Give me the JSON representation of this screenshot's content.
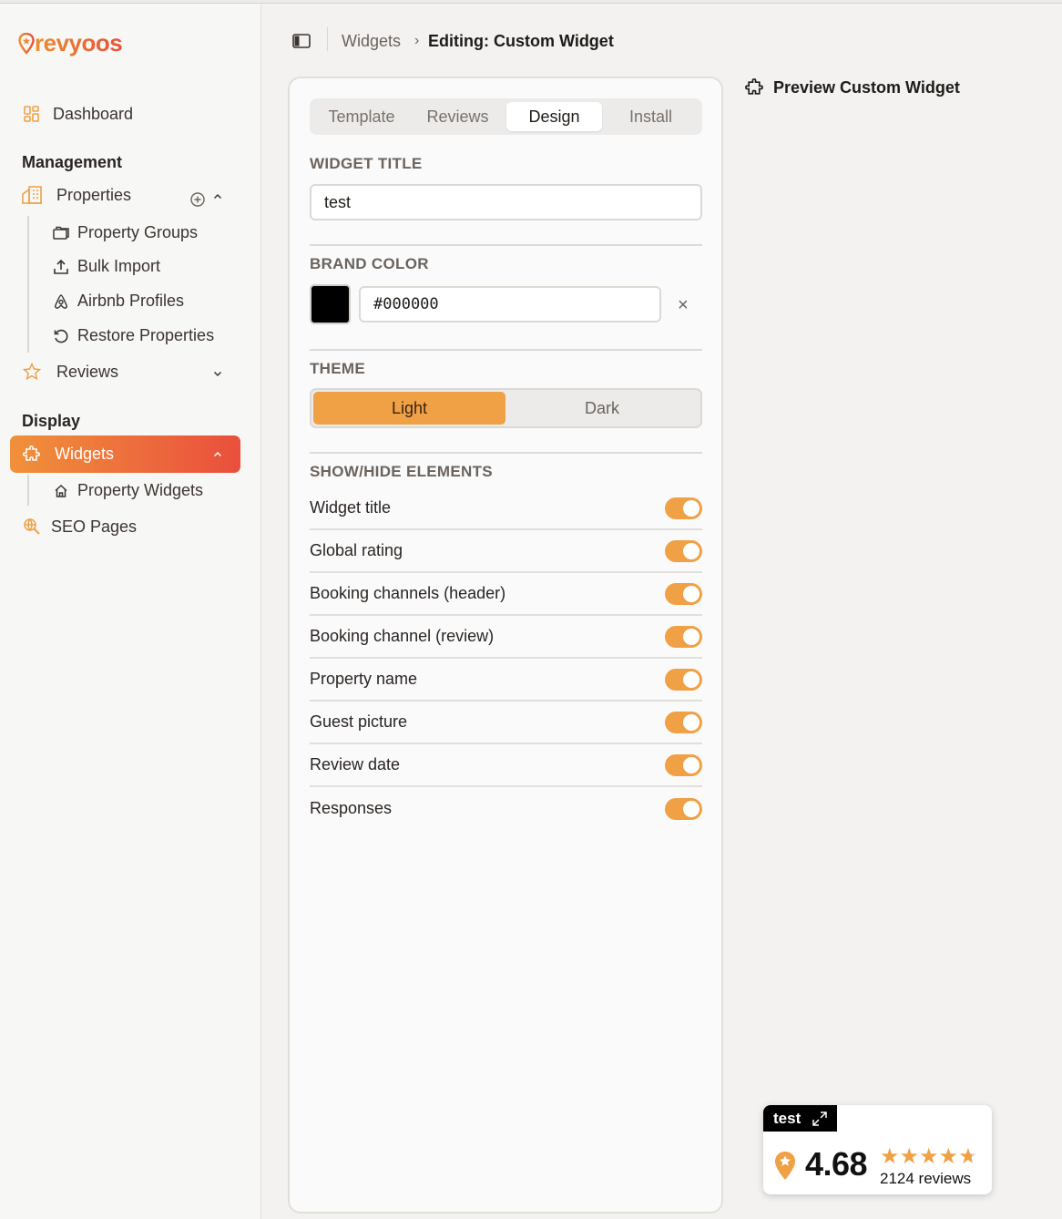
{
  "brand": {
    "name": "revyoos"
  },
  "sidebar": {
    "dashboard": "Dashboard",
    "management_title": "Management",
    "properties": "Properties",
    "property_groups": "Property Groups",
    "bulk_import": "Bulk Import",
    "airbnb_profiles": "Airbnb Profiles",
    "restore_properties": "Restore Properties",
    "reviews": "Reviews",
    "display_title": "Display",
    "widgets": "Widgets",
    "property_widgets": "Property Widgets",
    "seo_pages": "SEO Pages"
  },
  "header": {
    "crumb_root": "Widgets",
    "crumb_separator": "›",
    "crumb_current": "Editing: Custom Widget"
  },
  "tabs": [
    "Template",
    "Reviews",
    "Design",
    "Install"
  ],
  "active_tab": "Design",
  "design": {
    "widget_title_label": "WIDGET TITLE",
    "widget_title_value": "test",
    "brand_color_label": "BRAND COLOR",
    "brand_color_value": "#000000",
    "clear_symbol": "×",
    "theme_label": "THEME",
    "theme_light": "Light",
    "theme_dark": "Dark",
    "theme_selected": "Light",
    "show_hide_label": "SHOW/HIDE ELEMENTS",
    "toggles": [
      {
        "label": "Widget title",
        "on": true
      },
      {
        "label": "Global rating",
        "on": true
      },
      {
        "label": "Booking channels (header)",
        "on": true
      },
      {
        "label": "Booking channel (review)",
        "on": true
      },
      {
        "label": "Property name",
        "on": true
      },
      {
        "label": "Guest picture",
        "on": true
      },
      {
        "label": "Review date",
        "on": true
      },
      {
        "label": "Responses",
        "on": true
      }
    ]
  },
  "preview": {
    "title": "Preview Custom Widget",
    "badge": {
      "title": "test",
      "rating": "4.68",
      "stars": 4.68,
      "reviews": "2124 reviews"
    }
  },
  "colors": {
    "accent": "#f0a045",
    "brand_gradient_start": "#f0913a",
    "brand_gradient_end": "#ea4f3d"
  }
}
